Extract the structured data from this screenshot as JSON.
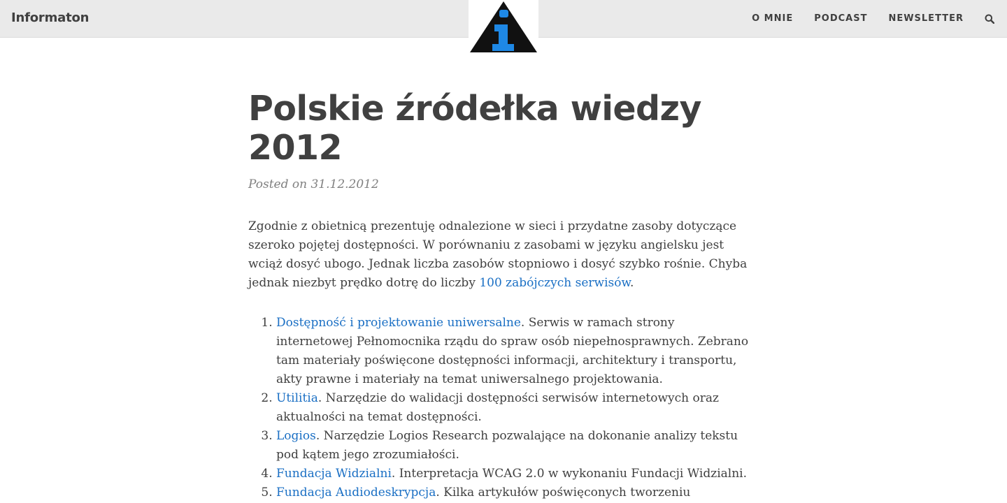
{
  "navbar": {
    "brand": "Informaton",
    "links": [
      "O MNIE",
      "PODCAST",
      "NEWSLETTER"
    ],
    "search_icon": "search-icon",
    "logo_icon": "info-triangle-icon"
  },
  "post": {
    "title": "Polskie źródełka wiedzy 2012",
    "meta": "Posted on 31.12.2012",
    "intro_text": "Zgodnie z obietnicą prezentuję odnalezione w sieci i przydatne zasoby dotyczące szeroko pojętej dostępności. W porównaniu z zasobami w języku angielsku jest wciąż dosyć ubogo. Jednak liczba zasobów stopniowo i dosyć szybko rośnie. Chyba jednak niezbyt prędko dotrę do liczby ",
    "intro_link": "100 zabójczych serwisów",
    "intro_end": ".",
    "items": [
      {
        "link": "Dostępność i projektowanie uniwersalne",
        "text": ". Serwis w ramach strony internetowej Pełnomocnika rządu do spraw osób niepełnosprawnych. Zebrano tam materiały poświęcone dostępności informacji, architektury i transportu, akty prawne i materiały na temat uniwersalnego projektowania."
      },
      {
        "link": "Utilitia",
        "text": ". Narzędzie do walidacji dostępności serwisów internetowych oraz aktualności na temat dostępności."
      },
      {
        "link": "Logios",
        "text": ". Narzędzie Logios Research pozwalające na dokonanie analizy tekstu pod kątem jego zrozumiałości."
      },
      {
        "link": "Fundacja Widzialni",
        "text": ". Interpretacja WCAG 2.0 w wykonaniu Fundacji Widzialni."
      },
      {
        "link": "Fundacja Audiodeskrypcja",
        "text": ". Kilka artykułów poświęconych tworzeniu"
      }
    ]
  },
  "colors": {
    "navbar_bg": "#eaeaea",
    "text": "#404040",
    "link": "#1a6fc4",
    "meta": "#808080",
    "logo_blue": "#1e88e5"
  }
}
